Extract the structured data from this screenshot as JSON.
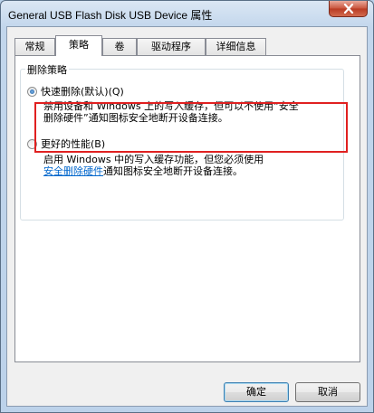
{
  "window": {
    "title": "General USB Flash Disk USB Device 属性"
  },
  "tabs": [
    {
      "label": "常规",
      "active": false
    },
    {
      "label": "策略",
      "active": true
    },
    {
      "label": "卷",
      "active": false
    },
    {
      "label": "驱动程序",
      "active": false
    },
    {
      "label": "详细信息",
      "active": false
    }
  ],
  "policy": {
    "group_label": "删除策略",
    "quick_removal": {
      "label": "快速删除(默认)(Q)",
      "checked": true,
      "desc_line1": "禁用设备和 Windows 上的写入缓存，但可以不使用“安全",
      "desc_line2": "删除硬件”通知图标安全地断开设备连接。"
    },
    "better_performance": {
      "label": "更好的性能(B)",
      "checked": false,
      "desc_line1": "启用 Windows 中的写入缓存功能，但您必须使用",
      "desc_link": "安全删除硬件",
      "desc_line2_rest": "通知图标安全地断开设备连接。"
    }
  },
  "buttons": {
    "ok": "确定",
    "cancel": "取消"
  },
  "colors": {
    "highlight_border": "#e02020",
    "link": "#0066cc"
  }
}
